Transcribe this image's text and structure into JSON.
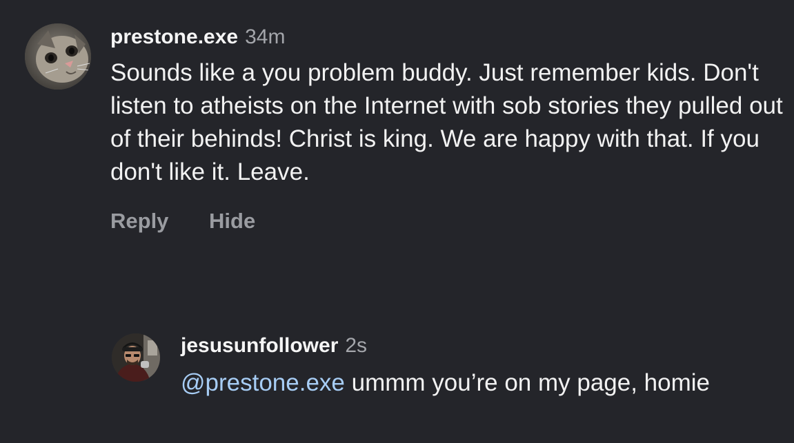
{
  "comments": [
    {
      "username": "prestone.exe",
      "time": "34m",
      "avatar_icon": "cat-avatar",
      "text": "Sounds like a you problem buddy. Just remember kids. Don't listen to atheists on the Internet with sob stories they pulled out of their behinds! Christ is king. We are happy with that. If you don't like it. Leave.",
      "actions": {
        "reply": "Reply",
        "hide": "Hide"
      }
    },
    {
      "username": "jesusunfollower",
      "time": "2s",
      "avatar_icon": "person-avatar",
      "mention": "@prestone.exe",
      "text": " ummm you’re on my page, homie"
    }
  ],
  "colors": {
    "background": "#24252a",
    "text": "#f2f2f2",
    "muted": "#a4a6ab",
    "action": "#9a9ca1",
    "mention": "#a7cdf5"
  }
}
